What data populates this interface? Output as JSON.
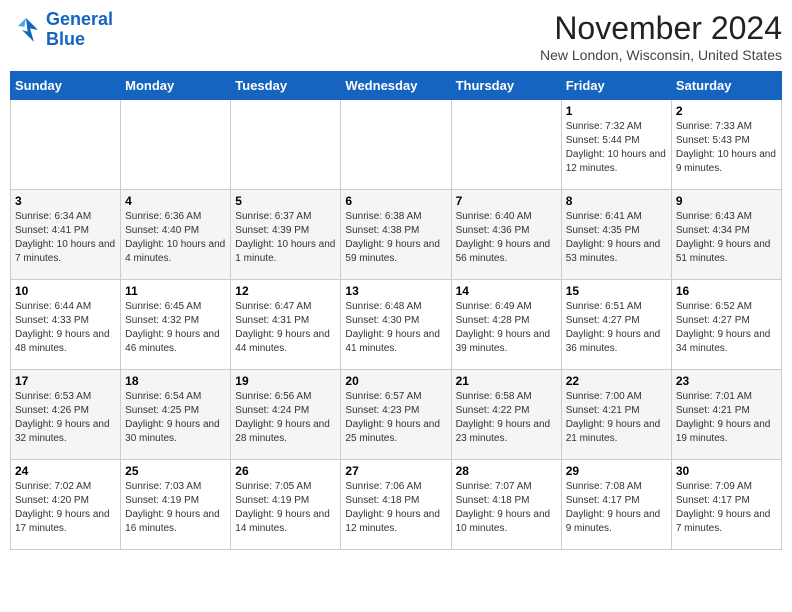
{
  "header": {
    "logo_line1": "General",
    "logo_line2": "Blue",
    "month": "November 2024",
    "location": "New London, Wisconsin, United States"
  },
  "weekdays": [
    "Sunday",
    "Monday",
    "Tuesday",
    "Wednesday",
    "Thursday",
    "Friday",
    "Saturday"
  ],
  "weeks": [
    [
      {
        "day": "",
        "info": ""
      },
      {
        "day": "",
        "info": ""
      },
      {
        "day": "",
        "info": ""
      },
      {
        "day": "",
        "info": ""
      },
      {
        "day": "",
        "info": ""
      },
      {
        "day": "1",
        "info": "Sunrise: 7:32 AM\nSunset: 5:44 PM\nDaylight: 10 hours and 12 minutes."
      },
      {
        "day": "2",
        "info": "Sunrise: 7:33 AM\nSunset: 5:43 PM\nDaylight: 10 hours and 9 minutes."
      }
    ],
    [
      {
        "day": "3",
        "info": "Sunrise: 6:34 AM\nSunset: 4:41 PM\nDaylight: 10 hours and 7 minutes."
      },
      {
        "day": "4",
        "info": "Sunrise: 6:36 AM\nSunset: 4:40 PM\nDaylight: 10 hours and 4 minutes."
      },
      {
        "day": "5",
        "info": "Sunrise: 6:37 AM\nSunset: 4:39 PM\nDaylight: 10 hours and 1 minute."
      },
      {
        "day": "6",
        "info": "Sunrise: 6:38 AM\nSunset: 4:38 PM\nDaylight: 9 hours and 59 minutes."
      },
      {
        "day": "7",
        "info": "Sunrise: 6:40 AM\nSunset: 4:36 PM\nDaylight: 9 hours and 56 minutes."
      },
      {
        "day": "8",
        "info": "Sunrise: 6:41 AM\nSunset: 4:35 PM\nDaylight: 9 hours and 53 minutes."
      },
      {
        "day": "9",
        "info": "Sunrise: 6:43 AM\nSunset: 4:34 PM\nDaylight: 9 hours and 51 minutes."
      }
    ],
    [
      {
        "day": "10",
        "info": "Sunrise: 6:44 AM\nSunset: 4:33 PM\nDaylight: 9 hours and 48 minutes."
      },
      {
        "day": "11",
        "info": "Sunrise: 6:45 AM\nSunset: 4:32 PM\nDaylight: 9 hours and 46 minutes."
      },
      {
        "day": "12",
        "info": "Sunrise: 6:47 AM\nSunset: 4:31 PM\nDaylight: 9 hours and 44 minutes."
      },
      {
        "day": "13",
        "info": "Sunrise: 6:48 AM\nSunset: 4:30 PM\nDaylight: 9 hours and 41 minutes."
      },
      {
        "day": "14",
        "info": "Sunrise: 6:49 AM\nSunset: 4:28 PM\nDaylight: 9 hours and 39 minutes."
      },
      {
        "day": "15",
        "info": "Sunrise: 6:51 AM\nSunset: 4:27 PM\nDaylight: 9 hours and 36 minutes."
      },
      {
        "day": "16",
        "info": "Sunrise: 6:52 AM\nSunset: 4:27 PM\nDaylight: 9 hours and 34 minutes."
      }
    ],
    [
      {
        "day": "17",
        "info": "Sunrise: 6:53 AM\nSunset: 4:26 PM\nDaylight: 9 hours and 32 minutes."
      },
      {
        "day": "18",
        "info": "Sunrise: 6:54 AM\nSunset: 4:25 PM\nDaylight: 9 hours and 30 minutes."
      },
      {
        "day": "19",
        "info": "Sunrise: 6:56 AM\nSunset: 4:24 PM\nDaylight: 9 hours and 28 minutes."
      },
      {
        "day": "20",
        "info": "Sunrise: 6:57 AM\nSunset: 4:23 PM\nDaylight: 9 hours and 25 minutes."
      },
      {
        "day": "21",
        "info": "Sunrise: 6:58 AM\nSunset: 4:22 PM\nDaylight: 9 hours and 23 minutes."
      },
      {
        "day": "22",
        "info": "Sunrise: 7:00 AM\nSunset: 4:21 PM\nDaylight: 9 hours and 21 minutes."
      },
      {
        "day": "23",
        "info": "Sunrise: 7:01 AM\nSunset: 4:21 PM\nDaylight: 9 hours and 19 minutes."
      }
    ],
    [
      {
        "day": "24",
        "info": "Sunrise: 7:02 AM\nSunset: 4:20 PM\nDaylight: 9 hours and 17 minutes."
      },
      {
        "day": "25",
        "info": "Sunrise: 7:03 AM\nSunset: 4:19 PM\nDaylight: 9 hours and 16 minutes."
      },
      {
        "day": "26",
        "info": "Sunrise: 7:05 AM\nSunset: 4:19 PM\nDaylight: 9 hours and 14 minutes."
      },
      {
        "day": "27",
        "info": "Sunrise: 7:06 AM\nSunset: 4:18 PM\nDaylight: 9 hours and 12 minutes."
      },
      {
        "day": "28",
        "info": "Sunrise: 7:07 AM\nSunset: 4:18 PM\nDaylight: 9 hours and 10 minutes."
      },
      {
        "day": "29",
        "info": "Sunrise: 7:08 AM\nSunset: 4:17 PM\nDaylight: 9 hours and 9 minutes."
      },
      {
        "day": "30",
        "info": "Sunrise: 7:09 AM\nSunset: 4:17 PM\nDaylight: 9 hours and 7 minutes."
      }
    ]
  ]
}
